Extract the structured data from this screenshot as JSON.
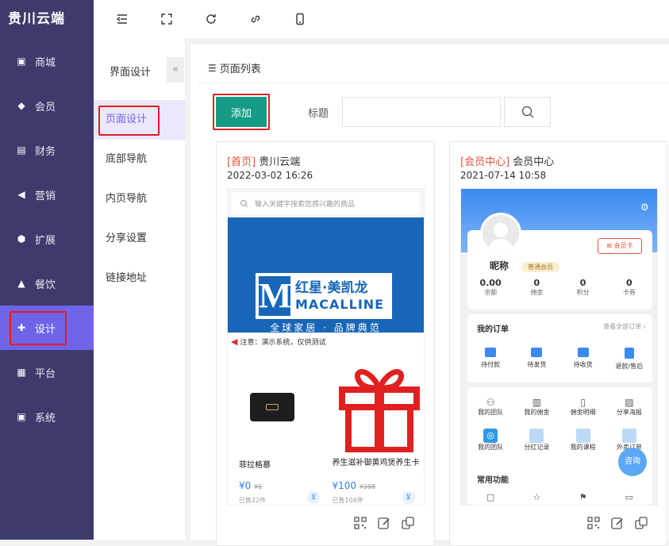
{
  "brand": "贵川云端",
  "sidebar": {
    "items": [
      {
        "label": "商城",
        "icon": "shop-icon"
      },
      {
        "label": "会员",
        "icon": "member-icon"
      },
      {
        "label": "财务",
        "icon": "finance-icon"
      },
      {
        "label": "营销",
        "icon": "marketing-icon"
      },
      {
        "label": "扩展",
        "icon": "extension-icon"
      },
      {
        "label": "餐饮",
        "icon": "catering-icon"
      },
      {
        "label": "设计",
        "icon": "puzzle-icon"
      },
      {
        "label": "平台",
        "icon": "grid-icon"
      },
      {
        "label": "系统",
        "icon": "system-icon"
      }
    ],
    "active_index": 6
  },
  "topbar": {
    "icons": [
      "menu-fold-icon",
      "fullscreen-icon",
      "refresh-icon",
      "link-icon",
      "mobile-icon"
    ]
  },
  "submenu": {
    "title": "界面设计",
    "collapse": "«",
    "items": [
      "页面设计",
      "底部导航",
      "内页导航",
      "分享设置",
      "链接地址"
    ],
    "active_index": 0
  },
  "panel": {
    "title": "页面列表"
  },
  "toolbar": {
    "add_label": "添加",
    "title_label": "标题",
    "search_value": "",
    "search_placeholder": ""
  },
  "cards": [
    {
      "tag": "[首页]",
      "name": "贵川云端",
      "time": "2022-03-02 16:26",
      "preview": {
        "search_placeholder": "输入关键字搜索您感兴趣的商品",
        "banner_brand": "红星·美凯龙",
        "banner_latin": "MACALLINE",
        "banner_slogan": "全球家居 · 品牌典范",
        "notice": "注意：演示系统，仅供测试",
        "products": [
          {
            "name": "菲拉格慕",
            "price": "¥0",
            "old_price": "¥1",
            "sold": "已售22件"
          },
          {
            "name": "养生滋补御黄鸡煲养生卡",
            "price": "¥100",
            "old_price": "¥288",
            "sold": "已售104件"
          }
        ]
      }
    },
    {
      "tag": "[会员中心]",
      "name": "会员中心",
      "time": "2021-07-14 10:58",
      "preview": {
        "nickname": "昵称",
        "level": "普通会员",
        "member_card": "会员卡",
        "stats": [
          {
            "value": "0.00",
            "label": "余额"
          },
          {
            "value": "0",
            "label": "佣金"
          },
          {
            "value": "0",
            "label": "积分"
          },
          {
            "value": "0",
            "label": "卡券"
          }
        ],
        "orders_title": "我的订单",
        "orders_all": "查看全部订单",
        "orders": [
          "待付款",
          "待发货",
          "待收货",
          "退款/售后"
        ],
        "grid1": [
          "我的团队",
          "我的佣金",
          "佣金明细",
          "分享海报"
        ],
        "grid2": [
          "我的团队",
          "分红记录",
          "我的课程",
          "外卖订单"
        ],
        "consult": "咨询",
        "common_title": "常用功能"
      }
    }
  ],
  "colors": {
    "sidebar": "#3c3b6b",
    "accent": "#6f63ea",
    "add_button": "#169b86",
    "highlight": "#e02020",
    "member_blue": "#3a8af0"
  }
}
